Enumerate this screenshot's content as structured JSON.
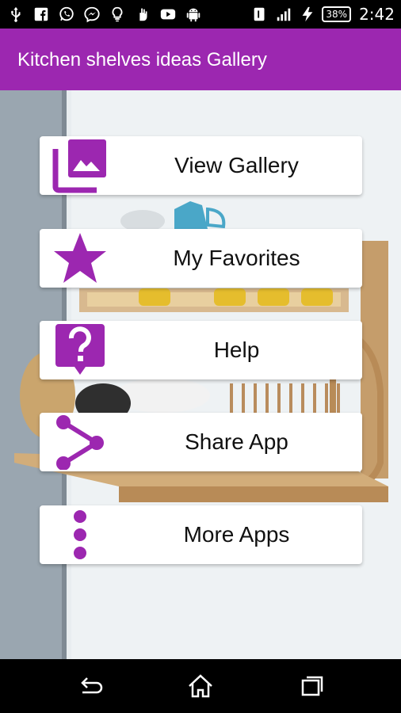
{
  "status_bar": {
    "battery_percent": "38%",
    "time": "2:42",
    "icons": [
      "usb-icon",
      "facebook-icon",
      "whatsapp-icon",
      "messenger-icon",
      "lightbulb-icon",
      "hand-icon",
      "youtube-icon",
      "android-icon",
      "sim-icon",
      "signal-icon",
      "charging-icon"
    ]
  },
  "app_bar": {
    "title": "Kitchen shelves ideas Gallery",
    "color": "#9c27b0"
  },
  "menu": {
    "accent_color": "#9c27b0",
    "items": [
      {
        "label": "View Gallery",
        "icon": "gallery-icon"
      },
      {
        "label": "My Favorites",
        "icon": "star-icon"
      },
      {
        "label": "Help",
        "icon": "help-icon"
      },
      {
        "label": "Share App",
        "icon": "share-icon"
      },
      {
        "label": "More Apps",
        "icon": "more-vertical-icon"
      }
    ]
  },
  "nav_bar": {
    "buttons": [
      "back-icon",
      "home-icon",
      "recents-icon"
    ]
  }
}
